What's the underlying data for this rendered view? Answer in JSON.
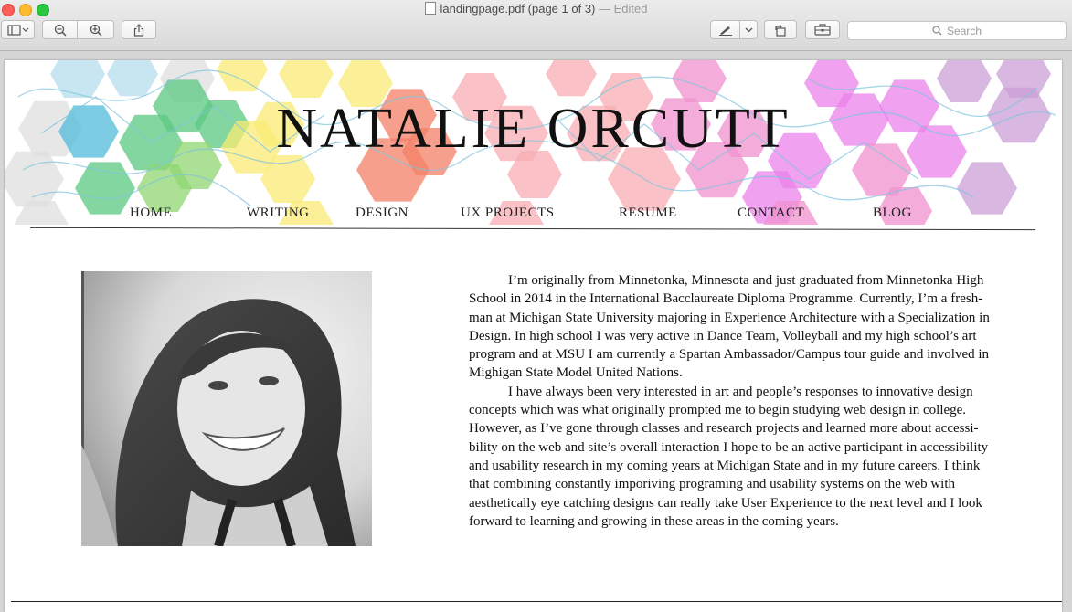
{
  "window": {
    "filename": "landingpage.pdf (page 1 of 3)",
    "separator": " — ",
    "status": "Edited"
  },
  "toolbar": {
    "sidebar_icon": "sidebar-icon",
    "zoom_out_icon": "zoom-out-icon",
    "zoom_in_icon": "zoom-in-icon",
    "share_icon": "share-icon",
    "markup_icon": "pen-icon",
    "rotate_icon": "rotate-icon",
    "toolbox_icon": "toolbox-icon",
    "search_placeholder": "Search"
  },
  "site": {
    "name": "NATALIE ORCUTT",
    "nav": [
      "HOME",
      "WRITING",
      "DESIGN",
      "UX PROJECTS",
      "RESUME",
      "CONTACT",
      "BLOG"
    ]
  },
  "bio": {
    "paragraph1": "I’m originally from Minnetonka, Minnesota and just graduated from Minnetonka High School in 2014 in the International Bacclaureate Diploma Programme. Currently, I’m a fresh-man at Michigan State University majoring in Experience Architecture with a Specialization in Design. In high school I was very active in Dance Team, Volleyball and my high school’s art program and at MSU I am currently a Spartan Ambassador/Campus tour guide and involved in Mighigan State Model United Nations.",
    "paragraph2": "I have always been very interested in art and people’s responses to innovative design concepts which was what originally prompted me to begin studying web design in college. However, as I’ve gone through classes and research projects and  learned more about accessi-bility on the web and site’s overall interaction I hope to be an active participant in accessibility and usability research in my coming years at Michigan State and in my future careers. I think that combining constantly imporiving programing and usability systems on the web with aesthetically eye catching designs can really take User Experience to the next level and I look forward to learning and growing in these areas in the coming years."
  },
  "colors": {
    "close": "#fc5f57",
    "minimize": "#fdbc2e",
    "maximize": "#29c840",
    "hex_palette": [
      "#31b0d5",
      "#3fbf6c",
      "#7ccf5a",
      "#f8e85c",
      "#f36a4c",
      "#f7a0a8",
      "#ee7fc6",
      "#e86ce8",
      "#c38fd0",
      "#a8d8ea",
      "#d9d9d9"
    ]
  }
}
